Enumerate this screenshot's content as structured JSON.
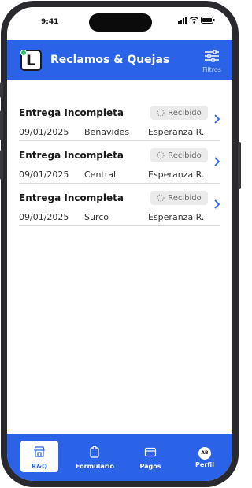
{
  "status_bar": {
    "time": "9:41"
  },
  "header": {
    "title": "Reclamos & Quejas",
    "logo_letter": "L",
    "filter_label": "Filtros"
  },
  "claims": [
    {
      "title": "Entrega Incompleta",
      "status": "Recibido",
      "date": "09/01/2025",
      "branch": "Benavides",
      "customer": "Esperanza R."
    },
    {
      "title": "Entrega Incompleta",
      "status": "Recibido",
      "date": "09/01/2025",
      "branch": "Central",
      "customer": "Esperanza R."
    },
    {
      "title": "Entrega Incompleta",
      "status": "Recibido",
      "date": "09/01/2025",
      "branch": "Surco",
      "customer": "Esperanza R."
    }
  ],
  "nav": {
    "items": [
      {
        "label": "R&Q"
      },
      {
        "label": "Formulario"
      },
      {
        "label": "Pagos"
      },
      {
        "label": "Perfil",
        "avatar": "AB"
      }
    ]
  },
  "colors": {
    "brand": "#2a63e8",
    "badge_bg": "#ebebeb",
    "logo_dot": "#22c55e"
  }
}
